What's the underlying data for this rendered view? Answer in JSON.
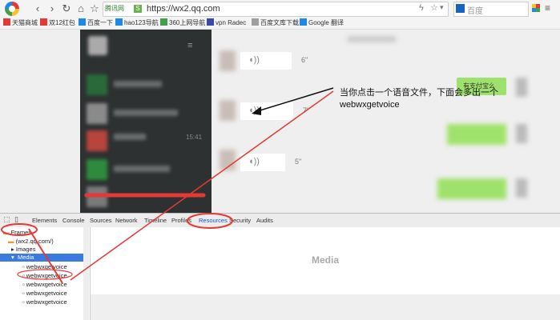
{
  "browser": {
    "address_badge": "腾讯网",
    "url": "https://wx2.qq.com",
    "search_placeholder": "百度"
  },
  "bookmarks": [
    {
      "label": "天猫商城",
      "color": "#e53935"
    },
    {
      "label": "双12红包",
      "color": "#e53935"
    },
    {
      "label": "百度一下",
      "color": "#1e88e5"
    },
    {
      "label": "hao123导航",
      "color": "#1e88e5"
    },
    {
      "label": "360上网导航",
      "color": "#43a047"
    },
    {
      "label": "vpn  Radec",
      "color": "#3949ab"
    },
    {
      "label": "百度文库下载",
      "color": "#9e9e9e"
    },
    {
      "label": "Google 翻译",
      "color": "#1e88e5"
    }
  ],
  "chat": {
    "durations": [
      "6\"",
      "7\"",
      "5\""
    ],
    "annotation_line1": "当你点击一个语音文件，下面会多出一个",
    "annotation_line2": "webwxgetvoice",
    "contact_time": "15:41",
    "bubble_text": "有支付宝么"
  },
  "devtools": {
    "tabs": [
      "Elements",
      "Console",
      "Sources",
      "Network",
      "Timeline",
      "Profiles",
      "Resources",
      "Security",
      "Audits"
    ],
    "active_tab": "Resources",
    "tree": {
      "frames": "Frames",
      "host": "(wx2.qq.com/)",
      "images": "Images",
      "media": "Media",
      "items": [
        "webwxgetvoice",
        "webwxgetvoice",
        "webwxgetvoice",
        "webwxgetvoice",
        "webwxgetvoice"
      ]
    },
    "panel_title": "Media"
  },
  "colors": {
    "annotation_red": "#e53935",
    "bubble_green": "#9fe26b",
    "selected_row": "#3b7be0"
  }
}
